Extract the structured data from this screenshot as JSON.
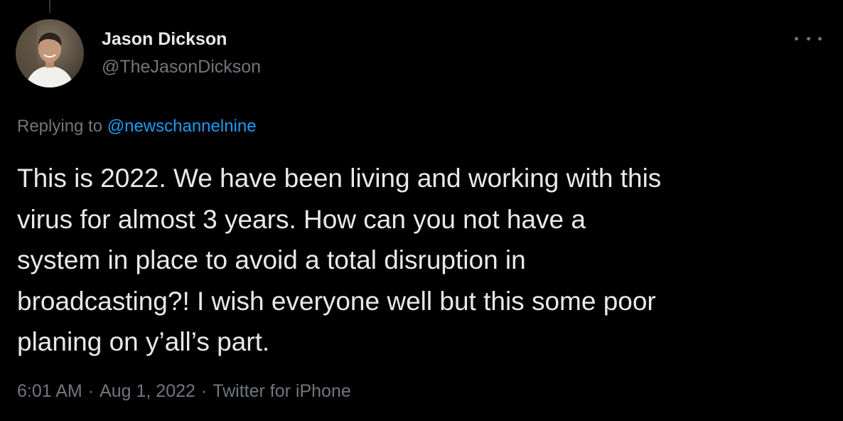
{
  "user": {
    "name": "Jason Dickson",
    "handle": "@TheJasonDickson",
    "avatar_icon": "profile-photo"
  },
  "reply": {
    "prefix": "Replying to",
    "mention": "@newschannelnine"
  },
  "tweet": {
    "lines": [
      "This is 2022. We have been living and working with this",
      "virus for almost 3 years. How can you not have a",
      "system in place to avoid a total disruption in",
      "broadcasting?! I wish everyone well but this some poor",
      "planing on y’all’s part."
    ]
  },
  "meta": {
    "time": "6:01 AM",
    "date": "Aug 1, 2022",
    "separator": "·",
    "source": "Twitter for iPhone"
  },
  "icons": {
    "more": "more-horizontal-icon"
  },
  "colors": {
    "background": "#000000",
    "text_primary": "#e7e9ea",
    "text_secondary": "#71767b",
    "link": "#1d9bf0"
  }
}
